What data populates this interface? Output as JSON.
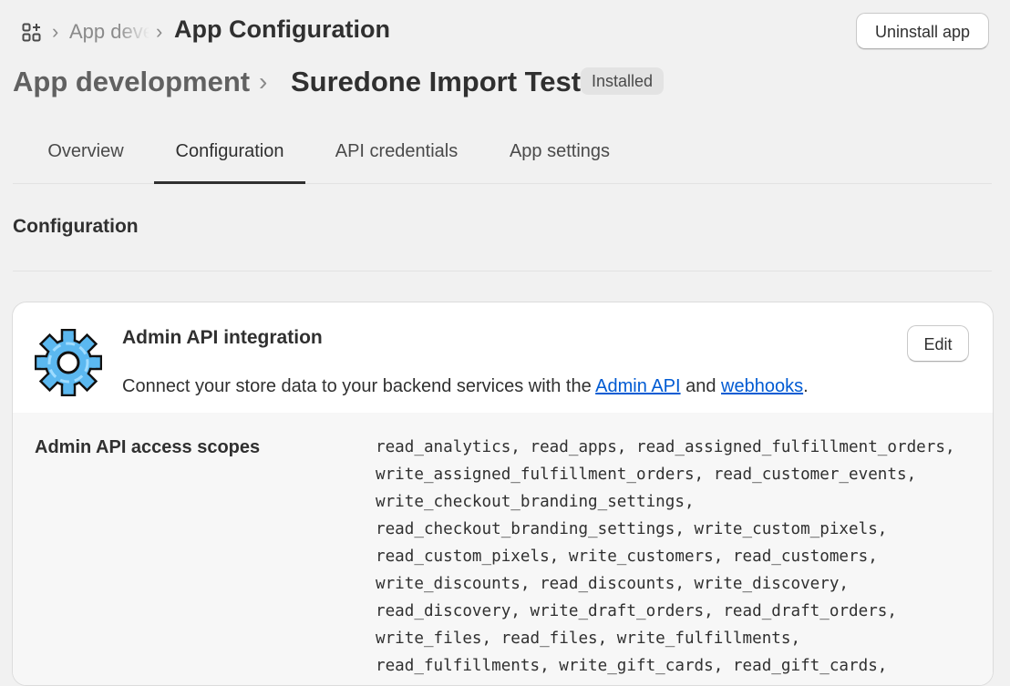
{
  "breadcrumb": {
    "apps_icon": "apps-grid-icon",
    "separator": "›",
    "parent": "App development",
    "current": "App Configuration"
  },
  "header": {
    "uninstall_label": "Uninstall app",
    "title_parent": "App development",
    "title_chevron": "›",
    "title_main": "Suredone Import Test",
    "status_badge": "Installed"
  },
  "tabs": [
    {
      "label": "Overview",
      "active": false
    },
    {
      "label": "Configuration",
      "active": true
    },
    {
      "label": "API credentials",
      "active": false
    },
    {
      "label": "App settings",
      "active": false
    }
  ],
  "section": {
    "title": "Configuration"
  },
  "card": {
    "icon": "gear-icon",
    "title": "Admin API integration",
    "edit_label": "Edit",
    "desc_prefix": "Connect your store data to your backend services with the ",
    "link_admin_api": "Admin API",
    "desc_mid": " and ",
    "link_webhooks": "webhooks",
    "desc_suffix": ".",
    "scopes_label": "Admin API access scopes",
    "scopes_lines": [
      "read_analytics, read_apps, read_assigned_fulfillment_orders,",
      "write_assigned_fulfillment_orders, read_customer_events,",
      "write_checkout_branding_settings,",
      "read_checkout_branding_settings, write_custom_pixels,",
      "read_custom_pixels, write_customers, read_customers,",
      "write_discounts, read_discounts, write_discovery,",
      "read_discovery, write_draft_orders, read_draft_orders,",
      "write_files, read_files, write_fulfillments,",
      "read_fulfillments, write_gift_cards, read_gift_cards,"
    ]
  },
  "colors": {
    "background": "#f1f1f1",
    "card": "#ffffff",
    "link": "#005bd3",
    "badge": "#e3e3e3",
    "gear": "#5bb8f0"
  }
}
